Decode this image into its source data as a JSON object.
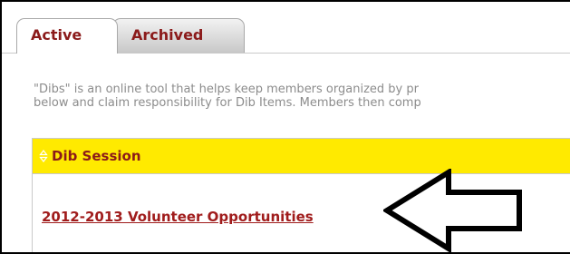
{
  "tabs": [
    {
      "label": "Active",
      "selected": true
    },
    {
      "label": "Archived",
      "selected": false
    }
  ],
  "description": {
    "line1": "\"Dibs\" is an online tool that helps keep members organized by pr",
    "line2": "below and claim responsibility for Dib Items. Members then comp"
  },
  "table": {
    "column_header": "Dib Session",
    "header_color": "#ffea00",
    "rows": [
      {
        "session": "2012-2013 Volunteer Opportunities"
      }
    ]
  },
  "annotation": {
    "icon": "arrow-left-outline-icon"
  },
  "colors": {
    "accent": "#8b1a1a",
    "link": "#a01c1c",
    "muted_text": "#8c8c8c"
  }
}
